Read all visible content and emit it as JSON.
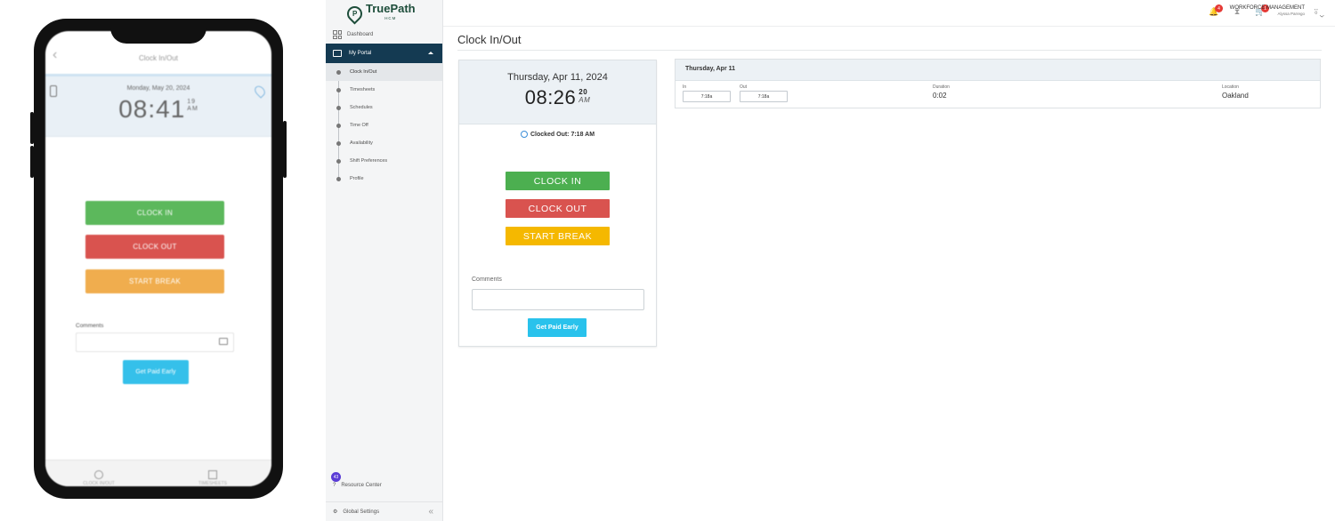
{
  "phone": {
    "header_title": "Clock In/Out",
    "date": "Monday, May 20, 2024",
    "time": "08:41",
    "seconds": "19",
    "ampm": "AM",
    "buttons": {
      "clock_in": "CLOCK IN",
      "clock_out": "CLOCK OUT",
      "start_break": "START BREAK"
    },
    "comments_label": "Comments",
    "get_paid_early": "Get Paid Early",
    "tabs": [
      "CLOCK IN/OUT",
      "TIMESHEETS"
    ],
    "colors": {
      "clock_in": "#5cb85c",
      "clock_out": "#d9534f",
      "start_break": "#f0ad4e",
      "get_paid_early": "#35c0ea"
    }
  },
  "sidebar": {
    "logo_name": "TruePath",
    "logo_sub": "HCM",
    "dashboard": "Dashboard",
    "my_portal": "My Portal",
    "items": [
      {
        "label": "Clock In/Out"
      },
      {
        "label": "Timesheets"
      },
      {
        "label": "Schedules"
      },
      {
        "label": "Time Off"
      },
      {
        "label": "Availability"
      },
      {
        "label": "Shift Preferences"
      },
      {
        "label": "Profile"
      }
    ],
    "resource_badge": "43",
    "resource_center": "Resource Center",
    "global_settings": "Global Settings"
  },
  "topbar": {
    "notif_count": "4",
    "cart_count": "1",
    "user_title": "WORKFORCE MANAGEMENT",
    "user_name": "Alyssa Parrego"
  },
  "main": {
    "page_title": "Clock In/Out",
    "card": {
      "date": "Thursday, Apr 11, 2024",
      "time": "08:26",
      "seconds": "20",
      "ampm": "AM",
      "clocked_status": "Clocked Out: 7:18 AM",
      "clock_in": "CLOCK IN",
      "clock_out": "CLOCK OUT",
      "start_break": "START BREAK",
      "comments_label": "Comments",
      "comments_value": "",
      "get_paid_early": "Get Paid Early",
      "colors": {
        "clock_in": "#4caf50",
        "clock_out": "#d9534f",
        "start_break": "#f5b800",
        "get_paid_early": "#29c2ec"
      }
    },
    "shift": {
      "date": "Thursday, Apr 11",
      "in_label": "In",
      "in_value": "7:18a",
      "out_label": "Out",
      "out_value": "7:18a",
      "duration_label": "Duration",
      "duration_value": "0:02",
      "location_label": "Location",
      "location_value": "Oakland"
    }
  }
}
